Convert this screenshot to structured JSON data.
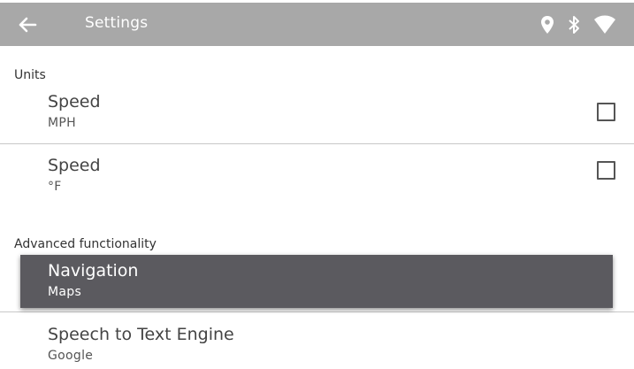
{
  "appbar": {
    "title": "Settings",
    "icons": [
      "back-arrow-icon",
      "location-pin-icon",
      "bluetooth-icon",
      "wifi-icon"
    ],
    "background": "#a8a8a8"
  },
  "sections": [
    {
      "title": "Units",
      "items": [
        {
          "primary": "Speed",
          "secondary": "MPH",
          "checked": false
        },
        {
          "primary": "Speed",
          "secondary": "°F",
          "checked": false
        }
      ]
    },
    {
      "title": "Advanced functionality",
      "items": [
        {
          "primary": "Navigation",
          "secondary": "Maps",
          "selected": true
        },
        {
          "primary": "Speech to Text Engine",
          "secondary": "Google"
        }
      ]
    }
  ],
  "colors": {
    "selected_background": "#5b5a5f",
    "divider": "#c8c8c8"
  }
}
